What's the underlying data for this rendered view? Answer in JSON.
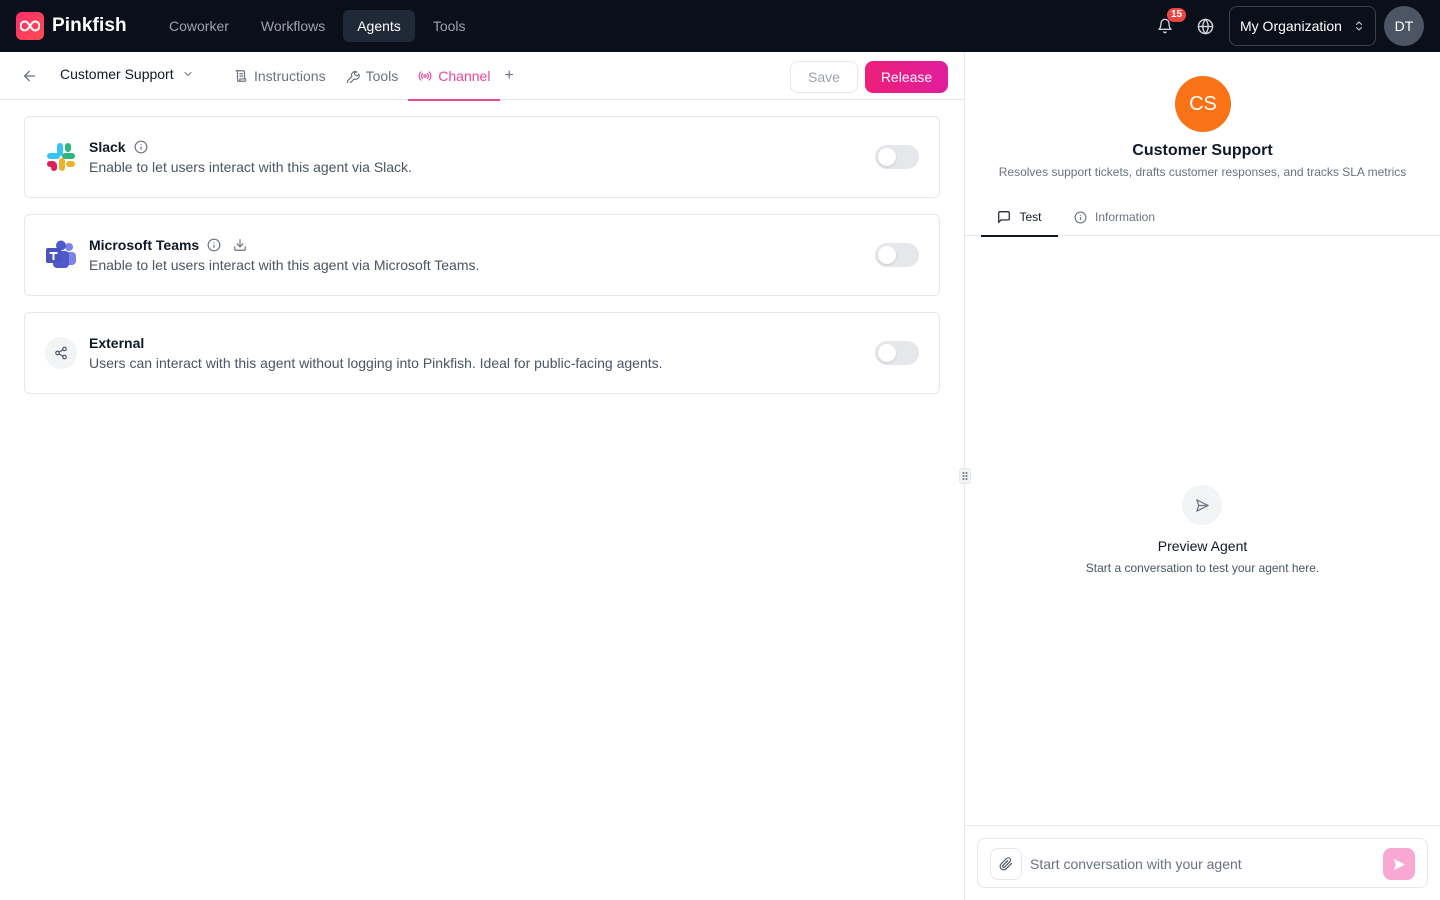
{
  "app": {
    "name": "Pinkfish"
  },
  "topnav": {
    "items": [
      {
        "label": "Coworker",
        "active": false
      },
      {
        "label": "Workflows",
        "active": false
      },
      {
        "label": "Agents",
        "active": true
      },
      {
        "label": "Tools",
        "active": false
      }
    ],
    "notifications_count": "15",
    "organization": "My Organization",
    "user_initials": "DT"
  },
  "subbar": {
    "agent_name": "Customer Support",
    "tabs": [
      {
        "label": "Instructions",
        "icon": "scroll-icon"
      },
      {
        "label": "Tools",
        "icon": "wrench-icon"
      },
      {
        "label": "Channel",
        "icon": "broadcast-icon",
        "active": true
      }
    ],
    "add_label": "+",
    "save_label": "Save",
    "release_label": "Release"
  },
  "channels": [
    {
      "name": "Slack",
      "description": "Enable to let users interact with this agent via Slack.",
      "enabled": false,
      "icon": "slack-icon"
    },
    {
      "name": "Microsoft Teams",
      "description": "Enable to let users interact with this agent via Microsoft Teams.",
      "enabled": false,
      "icon": "teams-icon"
    },
    {
      "name": "External",
      "description": "Users can interact with this agent without logging into Pinkfish. Ideal for public-facing agents.",
      "enabled": false,
      "icon": "share-icon"
    }
  ],
  "preview": {
    "avatar_initials": "CS",
    "agent_name": "Customer Support",
    "agent_description": "Resolves support tickets, drafts customer responses, and tracks SLA metrics",
    "tabs": [
      {
        "label": "Test",
        "active": true
      },
      {
        "label": "Information",
        "active": false
      }
    ],
    "empty_title": "Preview Agent",
    "empty_subtitle": "Start a conversation to test your agent here.",
    "composer_placeholder": "Start conversation with your agent",
    "composer_value": ""
  },
  "colors": {
    "accent": "#ec4899",
    "topbar_bg": "#0b0f19",
    "avatar_cs": "#f97316",
    "send_button": "#f9a8d4"
  }
}
